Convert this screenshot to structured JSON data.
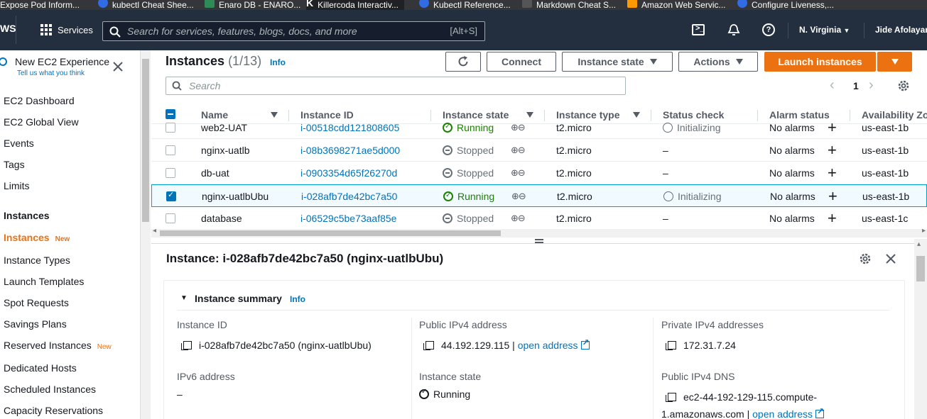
{
  "bookmarks": [
    {
      "label": "Expose Pod Inform...",
      "color": "#e0a030"
    },
    {
      "label": "kubectl Cheat Shee...",
      "color": "#326ce5"
    },
    {
      "label": "Enaro DB - ENARO...",
      "color": "#2e8b57"
    },
    {
      "label": "Killercoda Interactiv...",
      "color": "#000000"
    },
    {
      "label": "Kubectl Reference...",
      "color": "#326ce5"
    },
    {
      "label": "Markdown Cheat S...",
      "color": "#555555"
    },
    {
      "label": "Amazon Web Servic...",
      "color": "#ff9900"
    },
    {
      "label": "Configure Liveness,...",
      "color": "#326ce5"
    }
  ],
  "header": {
    "logo": "WS",
    "services_label": "Services",
    "search_placeholder": "Search for services, features, blogs, docs, and more",
    "search_shortcut": "[Alt+S]",
    "region": "N. Virginia",
    "user": "Jide Afolayan"
  },
  "sidebar": {
    "new_experience": "New EC2 Experience",
    "feedback": "Tell us what you think",
    "top_items": [
      "EC2 Dashboard",
      "EC2 Global View",
      "Events",
      "Tags",
      "Limits"
    ],
    "section_title": "Instances",
    "active_item": "Instances",
    "new_badge": "New",
    "section_items": [
      "Instance Types",
      "Launch Templates",
      "Spot Requests",
      "Savings Plans",
      "Reserved Instances",
      "Dedicated Hosts",
      "Scheduled Instances",
      "Capacity Reservations"
    ]
  },
  "toolbar": {
    "title": "Instances",
    "count": "(1/13)",
    "info": "Info",
    "connect": "Connect",
    "instance_state": "Instance state",
    "actions": "Actions",
    "launch": "Launch instances",
    "search_placeholder": "Search",
    "page": "1"
  },
  "table": {
    "columns": [
      "Name",
      "Instance ID",
      "Instance state",
      "Instance type",
      "Status check",
      "Alarm status",
      "Availability Zone"
    ],
    "rows": [
      {
        "name": "web2-UAT",
        "id": "i-00518cdd121808605",
        "state": "Running",
        "type": "t2.micro",
        "status": "Initializing",
        "alarm": "No alarms",
        "az": "us-east-1b",
        "selected": false
      },
      {
        "name": "nginx-uatlb",
        "id": "i-08b3698271ae5d000",
        "state": "Stopped",
        "type": "t2.micro",
        "status": "–",
        "alarm": "No alarms",
        "az": "us-east-1b",
        "selected": false
      },
      {
        "name": "db-uat",
        "id": "i-0903354d65f26270d",
        "state": "Stopped",
        "type": "t2.micro",
        "status": "–",
        "alarm": "No alarms",
        "az": "us-east-1b",
        "selected": false
      },
      {
        "name": "nginx-uatlbUbu",
        "id": "i-028afb7de42bc7a50",
        "state": "Running",
        "type": "t2.micro",
        "status": "Initializing",
        "alarm": "No alarms",
        "az": "us-east-1b",
        "selected": true
      },
      {
        "name": "database",
        "id": "i-06529c5be73aaf85e",
        "state": "Stopped",
        "type": "t2.micro",
        "status": "–",
        "alarm": "No alarms",
        "az": "us-east-1c",
        "selected": false
      }
    ]
  },
  "details": {
    "title": "Instance: i-028afb7de42bc7a50 (nginx-uatlbUbu)",
    "summary_label": "Instance summary",
    "info": "Info",
    "instance_id_label": "Instance ID",
    "instance_id_value": "i-028afb7de42bc7a50 (nginx-uatlbUbu)",
    "public_ip_label": "Public IPv4 address",
    "public_ip_value": "44.192.129.115",
    "open_address": "open address",
    "private_ip_label": "Private IPv4 addresses",
    "private_ip_value": "172.31.7.24",
    "ipv6_label": "IPv6 address",
    "ipv6_value": "–",
    "state_label": "Instance state",
    "state_value": "Running",
    "dns_label": "Public IPv4 DNS",
    "dns_value_1": "ec2-44-192-129-115.compute-",
    "dns_value_2": "1.amazonaws.com"
  },
  "colors": {
    "accent": "#ec7211",
    "link": "#0073bb",
    "running": "#1d8102",
    "header_bg": "#232f3e"
  }
}
